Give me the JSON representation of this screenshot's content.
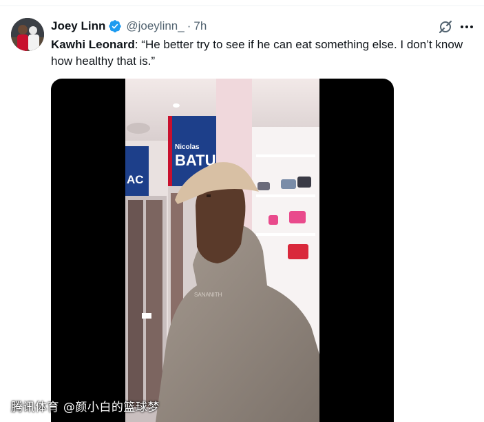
{
  "tweet": {
    "author_name": "Joey Linn",
    "handle": "@joeylinn_",
    "separator": "·",
    "time": "7h",
    "text_speaker": "Kawhi Leonard",
    "text_body": ": “He better try to see if he can eat something else. I don’t know how healthy that is.”"
  },
  "icons": {
    "verified": "verified-badge-icon",
    "grok": "grok-icon",
    "more": "more-options-icon"
  },
  "media": {
    "name_panel_first": "Nicolas",
    "name_panel_last": "BATUM",
    "name_panel_left": "AC",
    "hoodie_text": "SANANITH"
  },
  "watermark": "腾讯体育 @颜小白的篮球梦",
  "colors": {
    "verified_blue": "#1d9bf0",
    "text_primary": "#0f1419",
    "text_secondary": "#536471"
  }
}
